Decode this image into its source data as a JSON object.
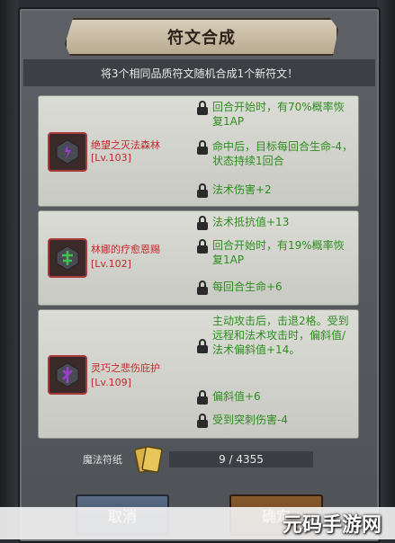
{
  "dialog": {
    "title": "符文合成",
    "subtitle": "将3个相同品质符文随机合成1个新符文！"
  },
  "runes": [
    {
      "name": "绝望之灭法森林",
      "level": "[Lv.103]",
      "icon": "purple-rune-stone-icon",
      "attrs": [
        "回合开始时，有70%概率恢复1AP",
        "命中后，目标每回合生命-4，状态持续1回合",
        "法术伤害+2"
      ]
    },
    {
      "name": "林娜的疗愈恩赐",
      "level": "[Lv.102]",
      "icon": "green-rune-stone-icon",
      "attrs": [
        "法术抵抗值+13",
        "回合开始时，有19%概率恢复1AP",
        "每回合生命+6"
      ]
    },
    {
      "name": "灵巧之悲伤庇护",
      "level": "[Lv.109]",
      "icon": "purple-rune-stone-icon",
      "attrs": [
        "主动攻击后，击退2格。受到远程和法术攻击时，偏斜值/法术偏斜值+14。",
        "偏斜值+6",
        "受到突刺伤害-4"
      ]
    }
  ],
  "material": {
    "label": "魔法符纸",
    "progress_text": "9 / 4355",
    "icon": "magic-paper-icon"
  },
  "buttons": {
    "cancel": "取消",
    "confirm": "确定"
  },
  "watermark": "元码手游网",
  "colors": {
    "attr_green": "#2c8d1e",
    "name_red": "#c2282a",
    "panel": "#5d6166"
  }
}
